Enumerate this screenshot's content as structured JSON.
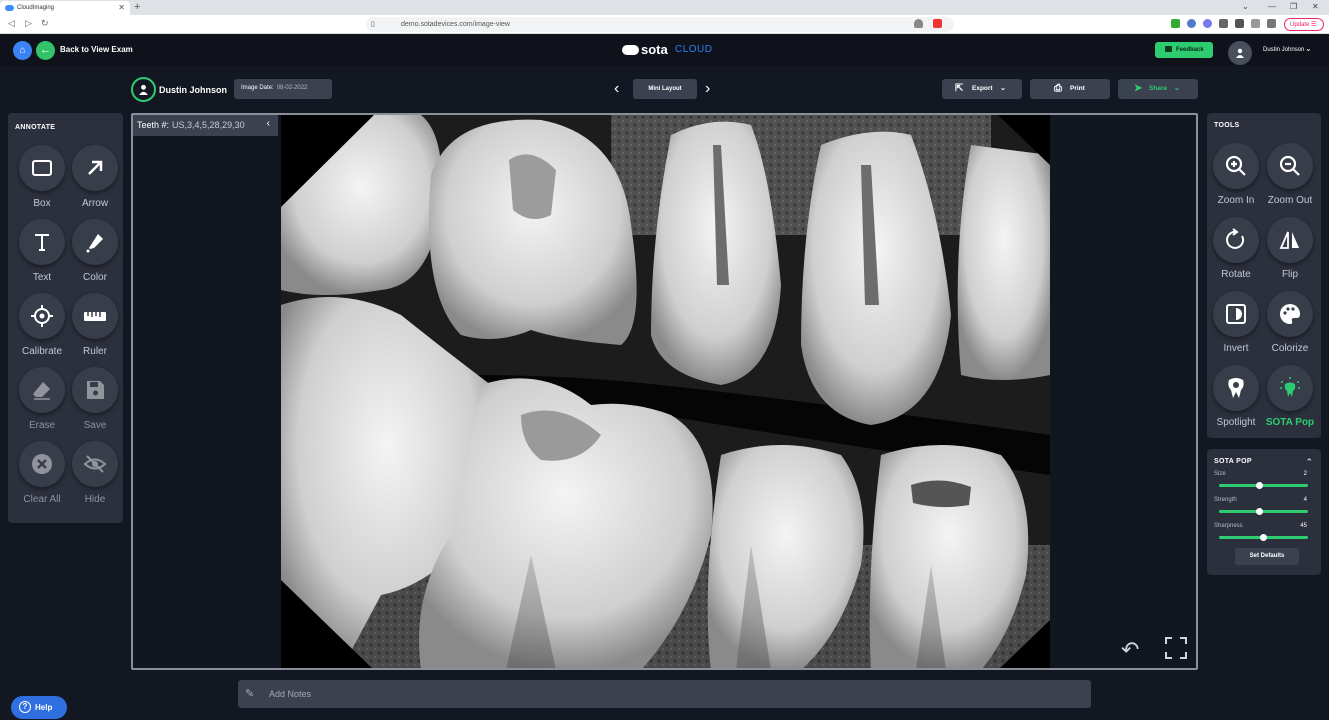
{
  "browser": {
    "tab_title": "CloudImaging",
    "url": "demo.sotadevices.com/image-view",
    "update_label": "Update"
  },
  "header": {
    "back_label": "Back to View Exam",
    "logo_word1": "sota",
    "logo_word2": "CLOUD",
    "feedback_label": "Feedback",
    "user_name": "Dustin Johnson"
  },
  "patient": {
    "name": "Dustin Johnson",
    "image_date_label": "Image Date:",
    "image_date": "08-02-2022"
  },
  "layout": {
    "mini_label": "Mini Layout"
  },
  "actions": {
    "export_label": "Export",
    "print_label": "Print",
    "share_label": "Share"
  },
  "annotate": {
    "title": "ANNOTATE",
    "tools": [
      {
        "label": "Box",
        "icon": "box-icon"
      },
      {
        "label": "Arrow",
        "icon": "arrow-icon"
      },
      {
        "label": "Text",
        "icon": "text-icon"
      },
      {
        "label": "Color",
        "icon": "eyedropper-icon"
      },
      {
        "label": "Calibrate",
        "icon": "crosshair-icon"
      },
      {
        "label": "Ruler",
        "icon": "ruler-icon"
      },
      {
        "label": "Erase",
        "icon": "eraser-icon"
      },
      {
        "label": "Save",
        "icon": "save-icon"
      },
      {
        "label": "Clear All",
        "icon": "clear-icon"
      },
      {
        "label": "Hide",
        "icon": "eye-off-icon"
      }
    ]
  },
  "viewer": {
    "teeth_label": "Teeth #:",
    "teeth_value": "US,3,4,5,28,29,30"
  },
  "tools": {
    "title": "TOOLS",
    "items": [
      {
        "label": "Zoom In",
        "icon": "zoom-in-icon"
      },
      {
        "label": "Zoom Out",
        "icon": "zoom-out-icon"
      },
      {
        "label": "Rotate",
        "icon": "rotate-icon"
      },
      {
        "label": "Flip",
        "icon": "flip-icon"
      },
      {
        "label": "Invert",
        "icon": "invert-icon"
      },
      {
        "label": "Colorize",
        "icon": "palette-icon"
      },
      {
        "label": "Spotlight",
        "icon": "spotlight-icon"
      },
      {
        "label": "SOTA Pop",
        "icon": "sota-pop-icon"
      }
    ]
  },
  "sota_pop": {
    "title": "SOTA POP",
    "sliders": [
      {
        "label": "Size",
        "value": "2",
        "fraction": 0.45
      },
      {
        "label": "Strength",
        "value": "4",
        "fraction": 0.45
      },
      {
        "label": "Sharpness",
        "value": "45",
        "fraction": 0.5
      }
    ],
    "set_defaults_label": "Set Defaults"
  },
  "notes": {
    "placeholder": "Add Notes"
  },
  "help_label": "Help",
  "colors": {
    "accent_green": "#2ecc71",
    "accent_blue": "#3b82f6",
    "panel": "#2c303c",
    "background": "#131722"
  }
}
